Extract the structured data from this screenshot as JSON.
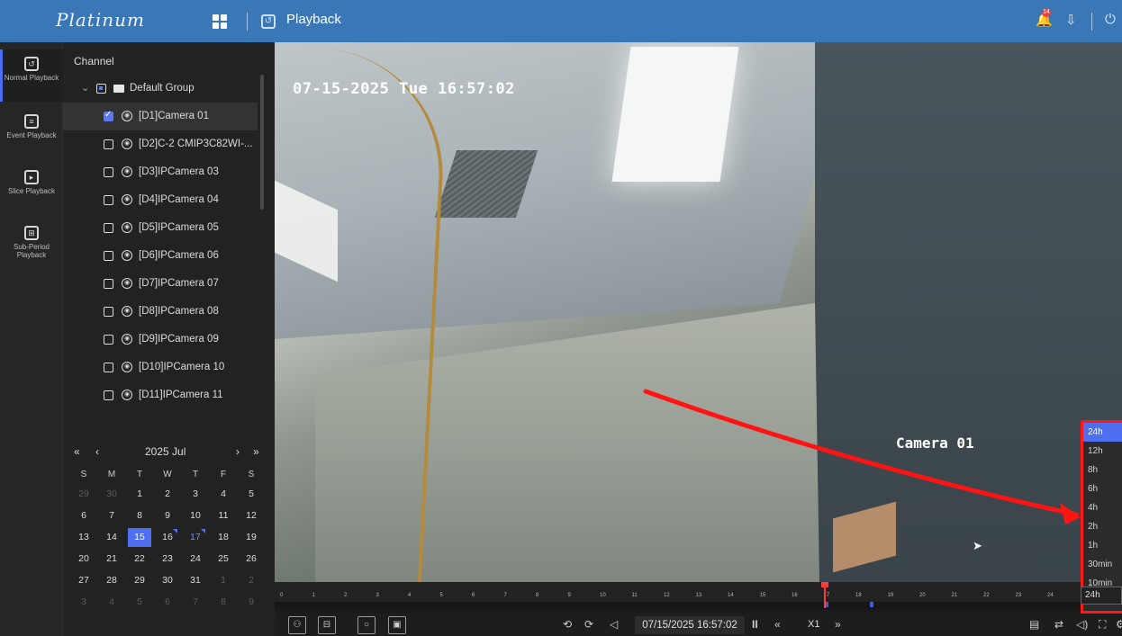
{
  "header": {
    "brand": "Platinum",
    "title": "Playback",
    "notification_count": "14"
  },
  "leftnav": [
    {
      "label": "Normal Playback",
      "icon": "normal-playback-icon",
      "active": true
    },
    {
      "label": "Event Playback",
      "icon": "event-playback-icon",
      "active": false
    },
    {
      "label": "Slice Playback",
      "icon": "slice-playback-icon",
      "active": false
    },
    {
      "label": "Sub-Period Playback",
      "icon": "sub-period-playback-icon",
      "active": false
    }
  ],
  "channel_panel": {
    "title": "Channel",
    "group": "Default Group",
    "channels": [
      {
        "label": "[D1]Camera 01",
        "checked": true
      },
      {
        "label": "[D2]C-2 CMIP3C82WI-...",
        "checked": false
      },
      {
        "label": "[D3]IPCamera 03",
        "checked": false
      },
      {
        "label": "[D4]IPCamera 04",
        "checked": false
      },
      {
        "label": "[D5]IPCamera 05",
        "checked": false
      },
      {
        "label": "[D6]IPCamera 06",
        "checked": false
      },
      {
        "label": "[D7]IPCamera 07",
        "checked": false
      },
      {
        "label": "[D8]IPCamera 08",
        "checked": false
      },
      {
        "label": "[D9]IPCamera 09",
        "checked": false
      },
      {
        "label": "[D10]IPCamera 10",
        "checked": false
      },
      {
        "label": "[D11]IPCamera 11",
        "checked": false
      }
    ]
  },
  "calendar": {
    "month_label": "2025 Jul",
    "nav": {
      "prev_year": "«",
      "prev_month": "‹",
      "next_month": "›",
      "next_year": "»"
    },
    "weekdays": [
      "S",
      "M",
      "T",
      "W",
      "T",
      "F",
      "S"
    ],
    "days": [
      [
        "29",
        "30",
        "1",
        "2",
        "3",
        "4",
        "5"
      ],
      [
        "6",
        "7",
        "8",
        "9",
        "10",
        "11",
        "12"
      ],
      [
        "13",
        "14",
        "15",
        "16",
        "17",
        "18",
        "19"
      ],
      [
        "20",
        "21",
        "22",
        "23",
        "24",
        "25",
        "26"
      ],
      [
        "27",
        "28",
        "29",
        "30",
        "31",
        "1",
        "2"
      ],
      [
        "3",
        "4",
        "5",
        "6",
        "7",
        "8",
        "9"
      ]
    ],
    "selected_day": "15",
    "recorded_day": "17",
    "marked_days": [
      "16",
      "17"
    ]
  },
  "video": {
    "osd_timestamp": "07-15-2025 Tue 16:57:02",
    "osd_camera_name": "Camera 01"
  },
  "zoom_menu": {
    "options": [
      "24h",
      "12h",
      "8h",
      "6h",
      "4h",
      "2h",
      "1h",
      "30min",
      "10min"
    ],
    "selected": "24h"
  },
  "timeline": {
    "hours": [
      "0",
      "1",
      "2",
      "3",
      "4",
      "5",
      "6",
      "7",
      "8",
      "9",
      "10",
      "11",
      "12",
      "13",
      "14",
      "15",
      "16",
      "17",
      "18",
      "19",
      "20",
      "21",
      "22",
      "23",
      "24"
    ],
    "current_hour_fraction": 16.95,
    "recordings": [
      [
        17.0,
        17.08
      ],
      [
        18.4,
        18.5
      ]
    ],
    "zoom_value": "24h"
  },
  "toolbar": {
    "current_time": "07/15/2025 16:57:02",
    "speed": "X1",
    "pause_label": "II",
    "rewind_label": "«",
    "forward_label": "»",
    "play_back_label": "◁"
  }
}
